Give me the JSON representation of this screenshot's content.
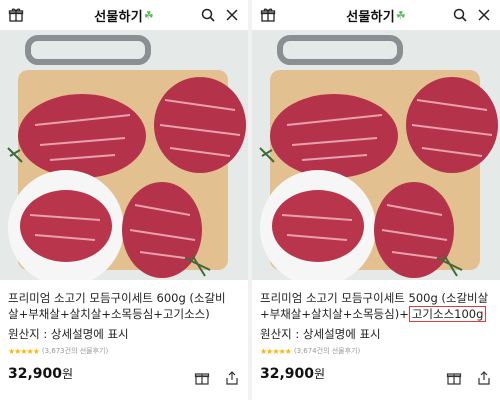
{
  "left": {
    "header": {
      "title": "선물하기",
      "clover": "☘"
    },
    "product": {
      "name_line1": "프리미엄 소고기 모듬구이세트 600g (소갈비",
      "name_line2": "살+부채살+살치살+소목등심+고기소스)",
      "origin": "원산지 : 상세설명에 표시",
      "stars": "★★★★★",
      "reviews": "(3,673건의 선물후기)",
      "price": "32,900",
      "currency": "원"
    }
  },
  "right": {
    "header": {
      "title": "선물하기",
      "clover": "☘"
    },
    "product": {
      "name_line1": "프리미엄 소고기 모듬구이세트 500g (소갈비살",
      "name_line2": "+부채살+살치살+소목등심)+",
      "name_highlight": "고기소스100g",
      "origin": "원산지 : 상세설명에 표시",
      "stars": "★★★★★",
      "reviews": "(3,674건의 선물후기)",
      "price": "32,900",
      "currency": "원"
    }
  },
  "icons": [
    "gift-icon",
    "search-icon",
    "close-icon",
    "share-icon"
  ],
  "colors": {
    "highlight_border": "#e23a3a",
    "star": "#ffb400",
    "clover": "#5cb85c"
  }
}
